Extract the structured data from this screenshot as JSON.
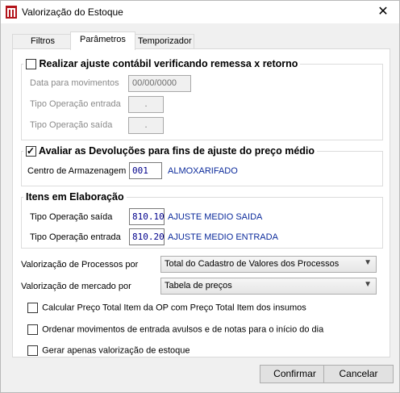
{
  "window": {
    "title": "Valorização do Estoque",
    "close": "✕"
  },
  "tabs": [
    {
      "label": "Filtros"
    },
    {
      "label": "Parâmetros"
    },
    {
      "label": "Temporizador"
    }
  ],
  "group_ajuste": {
    "title": "Realizar ajuste contábil verificando remessa x retorno",
    "checked": false,
    "data_label": "Data para movimentos",
    "data_value": "00/00/0000",
    "entrada_label": "Tipo Operação entrada",
    "entrada_value": ".",
    "saida_label": "Tipo Operação saída",
    "saida_value": "."
  },
  "group_devolucoes": {
    "title": "Avaliar as Devoluções para fins de ajuste do preço médio",
    "checked": true,
    "centro_label": "Centro de Armazenagem",
    "centro_value": "001",
    "centro_desc": "ALMOXARIFADO"
  },
  "group_itens": {
    "title": "Itens em Elaboração",
    "saida_label": "Tipo Operação saída",
    "saida_value": "810.10",
    "saida_desc": "AJUSTE MEDIO SAIDA",
    "entrada_label": "Tipo Operação entrada",
    "entrada_value": "810.20",
    "entrada_desc": "AJUSTE MEDIO ENTRADA"
  },
  "processos": {
    "label": "Valorização de Processos por",
    "value": "Total do Cadastro de Valores dos Processos"
  },
  "mercado": {
    "label": "Valorização de mercado por",
    "value": "Tabela de preços"
  },
  "options": [
    {
      "label": "Calcular Preço Total Item da OP com Preço Total Item dos insumos",
      "checked": false
    },
    {
      "label": "Ordenar movimentos de entrada avulsos e de notas para o início do dia",
      "checked": false
    },
    {
      "label": "Gerar apenas valorização de estoque",
      "checked": false
    }
  ],
  "buttons": {
    "confirm": "Confirmar",
    "cancel": "Cancelar"
  }
}
